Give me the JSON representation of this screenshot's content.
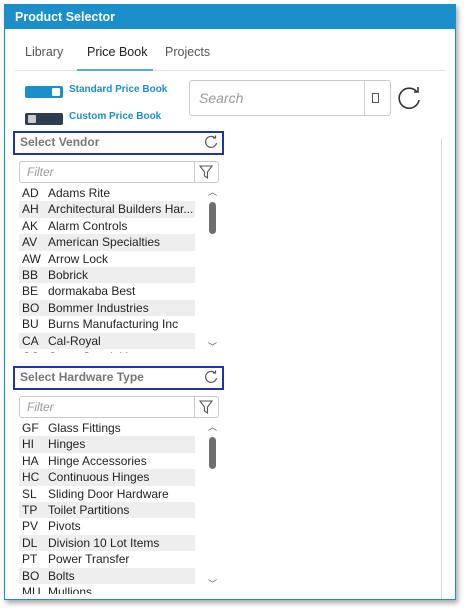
{
  "window": {
    "title": "Product Selector"
  },
  "tabs": [
    {
      "label": "Library",
      "active": false
    },
    {
      "label": "Price Book",
      "active": true
    },
    {
      "label": "Projects",
      "active": false
    }
  ],
  "toggles": [
    {
      "label": "Standard Price Book",
      "on": true,
      "color": "#1a8fc9"
    },
    {
      "label": "Custom Price Book",
      "on": false,
      "color": "#2c3e50"
    }
  ],
  "search": {
    "placeholder": "Search",
    "icon": "refresh-icon"
  },
  "vendor": {
    "header": "Select Vendor",
    "filter_placeholder": "Filter",
    "items": [
      {
        "code": "AD",
        "name": "Adams Rite"
      },
      {
        "code": "AH",
        "name": "Architectural Builders Har..."
      },
      {
        "code": "AK",
        "name": "Alarm Controls"
      },
      {
        "code": "AV",
        "name": "American Specialties"
      },
      {
        "code": "AW",
        "name": "Arrow Lock"
      },
      {
        "code": "BB",
        "name": "Bobrick"
      },
      {
        "code": "BE",
        "name": "dormakaba Best"
      },
      {
        "code": "BO",
        "name": "Bommer Industries"
      },
      {
        "code": "BU",
        "name": "Burns Manufacturing Inc"
      },
      {
        "code": "CA",
        "name": "Cal-Royal"
      },
      {
        "code": "CC",
        "name": "Cross Specialties"
      }
    ]
  },
  "hardware": {
    "header": "Select Hardware Type",
    "filter_placeholder": "Filter",
    "items": [
      {
        "code": "GF",
        "name": "Glass Fittings"
      },
      {
        "code": "HI",
        "name": "Hinges"
      },
      {
        "code": "HA",
        "name": "Hinge Accessories"
      },
      {
        "code": "HC",
        "name": "Continuous Hinges"
      },
      {
        "code": "SL",
        "name": "Sliding Door Hardware"
      },
      {
        "code": "TP",
        "name": "Toilet Partitions"
      },
      {
        "code": "PV",
        "name": "Pivots"
      },
      {
        "code": "DL",
        "name": "Division 10 Lot Items"
      },
      {
        "code": "PT",
        "name": "Power Transfer"
      },
      {
        "code": "BO",
        "name": "Bolts"
      },
      {
        "code": "MU",
        "name": "Mullions"
      }
    ]
  },
  "colors": {
    "accent": "#1a8fc9",
    "section_border": "#2233aa"
  }
}
